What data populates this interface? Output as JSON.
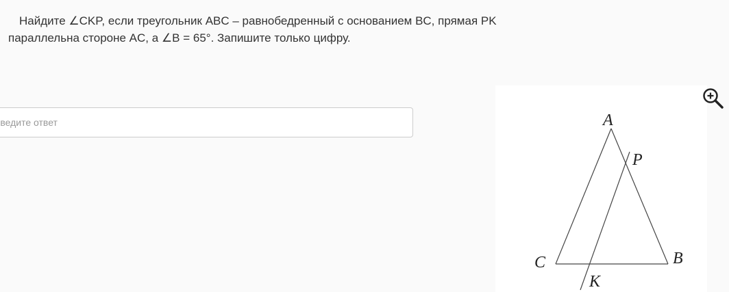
{
  "question": {
    "line1": "Найдите ∠CKP, если треугольник ABC – равнобедренный с основанием BC, прямая PK",
    "line2": "параллельна стороне AC, а ∠B = 65°. Запишите только цифру."
  },
  "answer": {
    "value": "",
    "placeholder": "Введите ответ"
  },
  "figure": {
    "labels": {
      "a": "A",
      "p": "P",
      "c": "C",
      "b": "B",
      "k": "K"
    }
  },
  "toolbar": {
    "zoom_icon": "zoom-in-icon"
  }
}
